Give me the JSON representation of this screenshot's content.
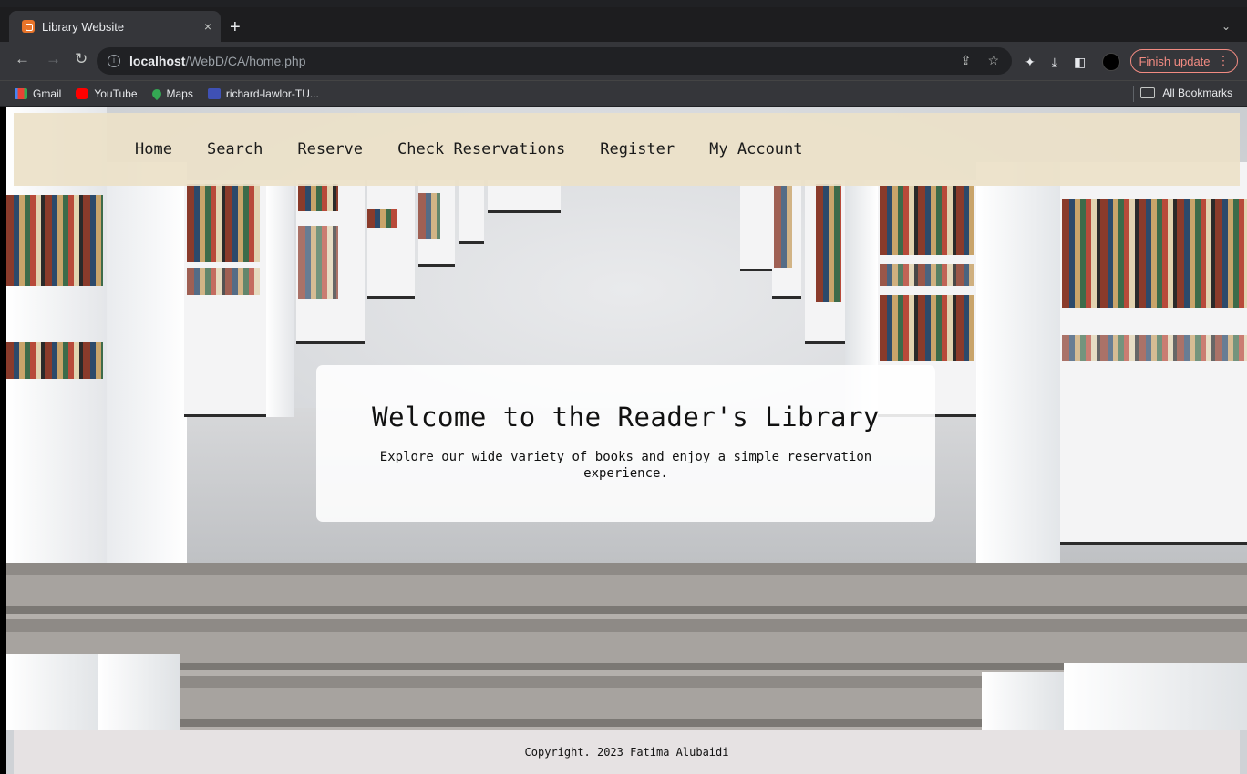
{
  "browser": {
    "tab_title": "Library Website",
    "tab_close": "×",
    "new_tab": "+",
    "tab_menu": "⌄",
    "url_host": "localhost",
    "url_path": "/WebD/CA/home.php",
    "finish_update": "Finish update",
    "bookmarks": [
      {
        "label": "Gmail",
        "icon": "gmail-icon"
      },
      {
        "label": "YouTube",
        "icon": "youtube-icon"
      },
      {
        "label": "Maps",
        "icon": "maps-icon"
      },
      {
        "label": "richard-lawlor-TU...",
        "icon": "bookmark-icon"
      }
    ],
    "all_bookmarks": "All Bookmarks"
  },
  "nav": {
    "items": [
      {
        "label": "Home"
      },
      {
        "label": "Search"
      },
      {
        "label": "Reserve"
      },
      {
        "label": "Check Reservations"
      },
      {
        "label": "Register"
      },
      {
        "label": "My Account"
      }
    ]
  },
  "hero": {
    "title": "Welcome to the Reader's Library",
    "text": "Explore our wide variety of books and enjoy a simple reservation experience."
  },
  "footer": {
    "text": "Copyright. 2023 Fatima Alubaidi"
  }
}
